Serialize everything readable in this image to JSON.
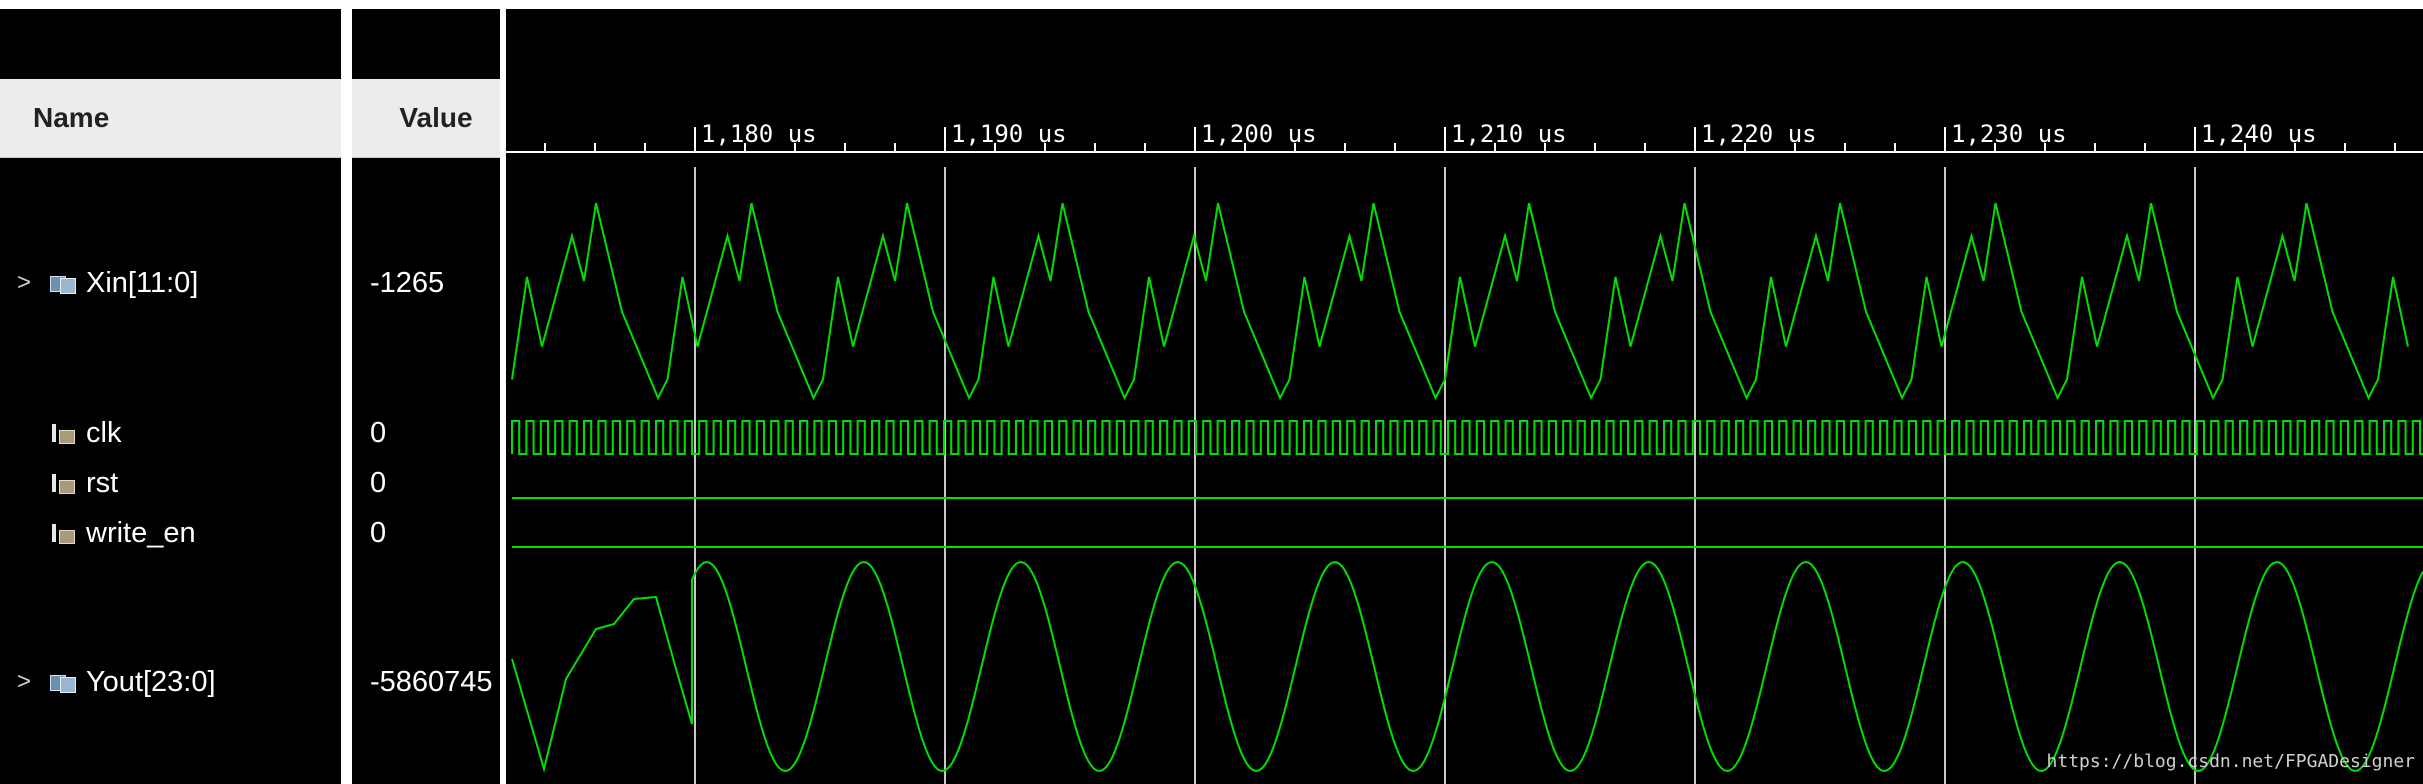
{
  "columns": {
    "name": "Name",
    "value": "Value"
  },
  "signals": [
    {
      "name": "Xin[11:0]",
      "value": "-1265",
      "kind": "bus",
      "expandable": true,
      "icon": "bus-icon"
    },
    {
      "name": "clk",
      "value": "0",
      "kind": "bit",
      "expandable": false,
      "icon": "bit-icon"
    },
    {
      "name": "rst",
      "value": "0",
      "kind": "bit",
      "expandable": false,
      "icon": "bit-icon"
    },
    {
      "name": "write_en",
      "value": "0",
      "kind": "bit",
      "expandable": false,
      "icon": "bit-icon"
    },
    {
      "name": "Yout[23:0]",
      "value": "-5860745",
      "kind": "bus",
      "expandable": true,
      "icon": "bus-icon"
    }
  ],
  "expander_glyph": ">",
  "timeline": {
    "labels": [
      "1,180 us",
      "1,190 us",
      "1,200 us",
      "1,210 us",
      "1,220 us",
      "1,230 us",
      "1,240 us"
    ],
    "major_ticks_us": [
      1180,
      1190,
      1200,
      1210,
      1220,
      1230,
      1240
    ],
    "minor_per_major": 5
  },
  "colors": {
    "waveform": "#00e000",
    "background": "#000000",
    "cursor_lines": "#c8c8c8"
  },
  "watermark": "https://blog.csdn.net/FPGADesigner"
}
